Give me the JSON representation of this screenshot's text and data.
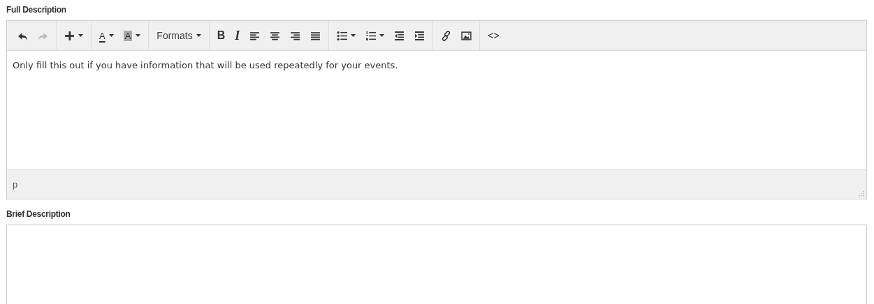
{
  "full_description": {
    "label": "Full Description",
    "toolbar": [
      [
        {
          "kind": "undo",
          "disabled": false
        },
        {
          "kind": "redo",
          "disabled": true
        }
      ],
      [
        {
          "kind": "insert",
          "dropdown": true
        }
      ],
      [
        {
          "kind": "text-color",
          "label": "A",
          "dropdown": true
        },
        {
          "kind": "background-color",
          "label": "A",
          "dropdown": true
        }
      ],
      [
        {
          "kind": "formats",
          "label": "Formats",
          "dropdown": true
        }
      ],
      [
        {
          "kind": "bold",
          "label": "B"
        },
        {
          "kind": "italic",
          "label": "I"
        },
        {
          "kind": "align-left"
        },
        {
          "kind": "align-center"
        },
        {
          "kind": "align-right"
        },
        {
          "kind": "align-justify"
        }
      ],
      [
        {
          "kind": "bullet-list",
          "dropdown": true
        },
        {
          "kind": "numbered-list",
          "dropdown": true
        },
        {
          "kind": "outdent"
        },
        {
          "kind": "indent"
        }
      ],
      [
        {
          "kind": "link"
        },
        {
          "kind": "image"
        }
      ],
      [
        {
          "kind": "source-code",
          "label": "<>"
        }
      ]
    ],
    "content": "Only fill this out if you have information that will be used repeatedly for your events.",
    "path": "p"
  },
  "brief_description": {
    "label": "Brief Description"
  }
}
